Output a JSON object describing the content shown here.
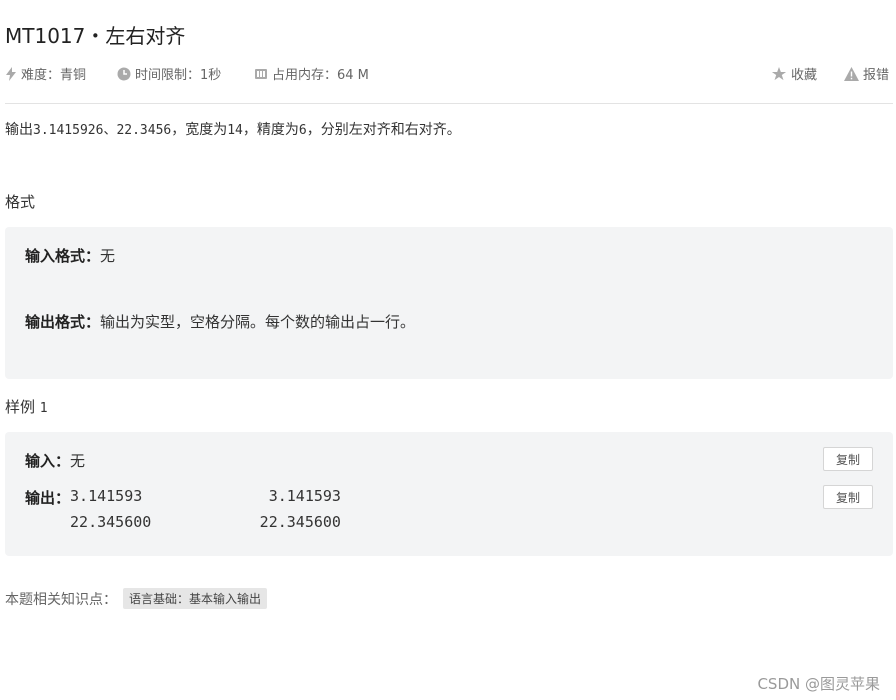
{
  "problem": {
    "title": "MT1017・左右对齐",
    "difficulty": "难度：青铜",
    "time_limit": "时间限制：1秒",
    "memory": "占用内存：64 M",
    "favorite": "收藏",
    "report": "报错"
  },
  "description": {
    "prefix": "输出",
    "values": "3.1415926、22.3456",
    "mid1": "，宽度为",
    "width": "14",
    "mid2": "，精度为",
    "precision": "6",
    "suffix": "，分别左对齐和右对齐。"
  },
  "format": {
    "heading": "格式",
    "input_label": "输入格式：",
    "input_value": "无",
    "output_label": "输出格式：",
    "output_value": "输出为实型，空格分隔。每个数的输出占一行。"
  },
  "sample": {
    "heading": "样例",
    "index": "1",
    "input_label": "输入：",
    "input_value": "无",
    "output_label": "输出：",
    "output_line1": "3.141593              3.141593",
    "output_line2": "22.345600            22.345600",
    "copy_label": "复制"
  },
  "knowledge": {
    "label": "本题相关知识点：",
    "tag": "语言基础：基本输入输出"
  },
  "watermark": "CSDN @图灵苹果"
}
